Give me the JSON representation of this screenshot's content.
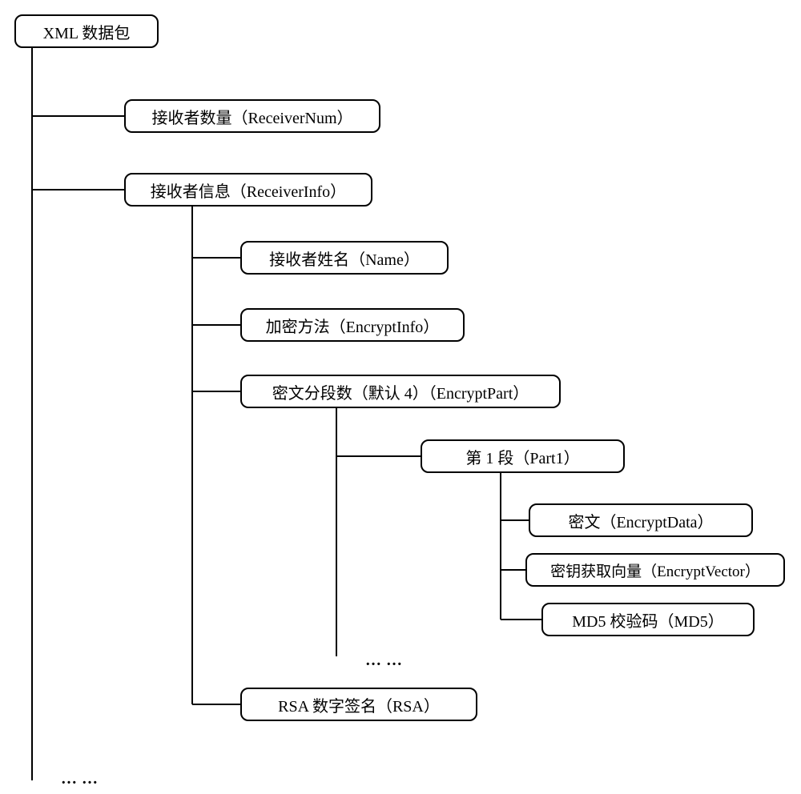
{
  "tree": {
    "root": {
      "label": "XML 数据包"
    },
    "receiver_num": {
      "label": "接收者数量（ReceiverNum）"
    },
    "receiver_info": {
      "label": "接收者信息（ReceiverInfo）"
    },
    "name": {
      "label": "接收者姓名（Name）"
    },
    "encrypt_info": {
      "label": "加密方法（EncryptInfo）"
    },
    "encrypt_part": {
      "label": "密文分段数（默认 4）（EncryptPart）"
    },
    "part1": {
      "label": "第 1 段（Part1）"
    },
    "encrypt_data": {
      "label": "密文（EncryptData）"
    },
    "encrypt_vector": {
      "label": "密钥获取向量（EncryptVector）"
    },
    "md5": {
      "label": "MD5 校验码（MD5）"
    },
    "rsa": {
      "label": "RSA 数字签名（RSA）"
    }
  },
  "ellipsis": "……"
}
